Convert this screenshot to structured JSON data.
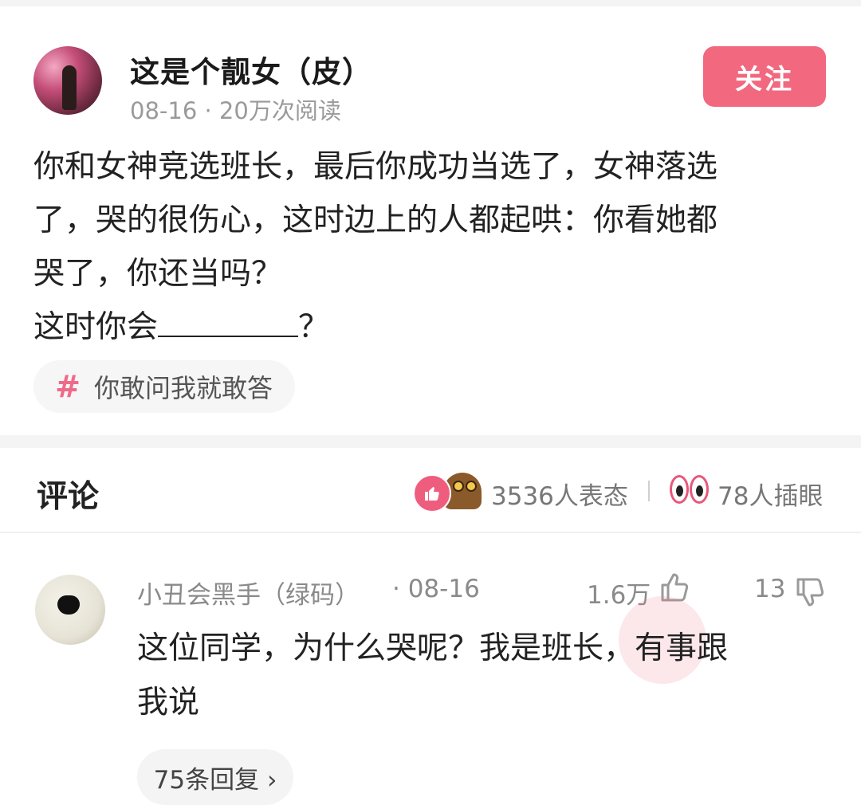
{
  "post": {
    "author": "这是个靓女（皮）",
    "meta": "08-16 · 20万次阅读",
    "follow_label": "关注",
    "lines": [
      "你和女神竞选班长，最后你成功当选了，女神落选",
      "了，哭的很伤心，这时边上的人都起哄：你看她都",
      "哭了，你还当吗？"
    ],
    "last_line_prefix": "这时你会",
    "last_line_suffix": "？",
    "topic": "你敢问我就敢答"
  },
  "comments_header": {
    "title": "评论",
    "reactions_text": "3536人表态",
    "eyes_text": "78人插眼"
  },
  "comment": {
    "user": "小丑会黑手（绿码）",
    "date": "· 08-16",
    "likes": "1.6万",
    "dislikes": "13",
    "lines": [
      "这位同学，为什么哭呢？我是班长，有事跟",
      "我说"
    ],
    "replies": "75条回复 ›"
  },
  "colors": {
    "accent": "#f2687f",
    "topic_hash": "#ef6a8a",
    "muted_text": "#8a8a8a"
  },
  "icons": {
    "reaction_1": "thumbs-up-icon",
    "reaction_2": "mole-emoji-icon",
    "eyes": "eyes-icon",
    "like": "thumb-up-icon",
    "dislike": "thumb-down-icon"
  }
}
